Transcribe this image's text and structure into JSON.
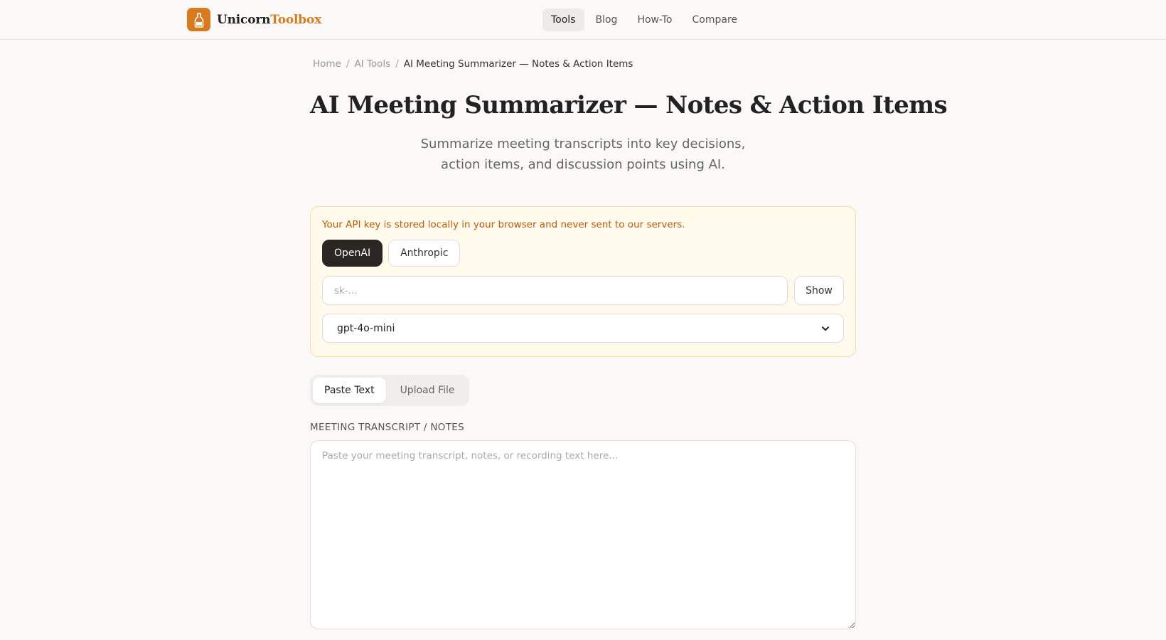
{
  "header": {
    "brand_name": "Unicorn",
    "brand_accent": "Toolbox",
    "brand_color": "#d97a1d",
    "nav": [
      {
        "label": "Tools",
        "active": true
      },
      {
        "label": "Blog",
        "active": false
      },
      {
        "label": "How-To",
        "active": false
      },
      {
        "label": "Compare",
        "active": false
      }
    ]
  },
  "breadcrumb": {
    "home": "Home",
    "section": "AI Tools",
    "current": "AI Meeting Summarizer — Notes & Action Items",
    "separator": "/"
  },
  "page": {
    "title": "AI Meeting Summarizer — Notes & Action Items",
    "subtitle": "Summarize meeting transcripts into key decisions, action items, and discussion points using AI."
  },
  "api_card": {
    "notice": "Your API key is stored locally in your browser and never sent to our servers.",
    "providers": [
      {
        "label": "OpenAI",
        "active": true
      },
      {
        "label": "Anthropic",
        "active": false
      }
    ],
    "key_placeholder": "sk-...",
    "show_label": "Show",
    "model_selected": "gpt-4o-mini"
  },
  "input_tabs": [
    {
      "label": "Paste Text",
      "active": true
    },
    {
      "label": "Upload File",
      "active": false
    }
  ],
  "transcript": {
    "label": "MEETING TRANSCRIPT / NOTES",
    "placeholder": "Paste your meeting transcript, notes, or recording text here..."
  },
  "icons": {
    "logo": "bottle-logo-icon",
    "select": "chevron-down-icon"
  }
}
